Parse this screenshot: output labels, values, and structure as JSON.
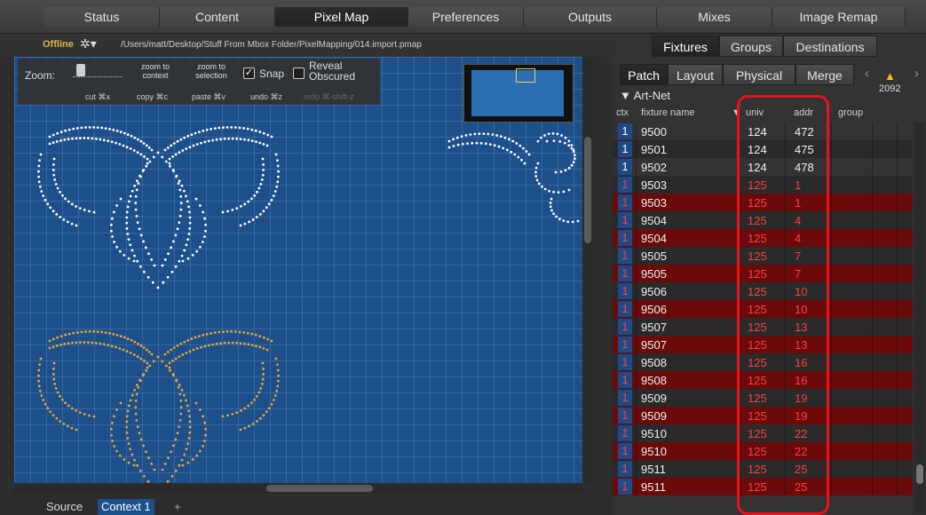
{
  "top_tabs": [
    {
      "label": "Status",
      "active": false
    },
    {
      "label": "Content",
      "active": false
    },
    {
      "label": "Pixel Map",
      "active": true
    },
    {
      "label": "Preferences",
      "active": false
    },
    {
      "label": "Outputs",
      "active": false
    },
    {
      "label": "Mixes",
      "active": false
    },
    {
      "label": "Image Remap",
      "active": false
    }
  ],
  "status": {
    "offline_label": "Offline",
    "gear_icon": "gear-dropdown-icon"
  },
  "file_path": "/Users/matt/Desktop/Stuff From Mbox Folder/PixelMapping/014.import.pmap",
  "toolbar": {
    "zoom_label": "Zoom:",
    "zoom_to_context": "zoom to\ncontext",
    "zoom_to_selection": "zoom to\nselection",
    "snap_label": "Snap",
    "snap_checked": true,
    "reveal_label": "Reveal\nObscured",
    "reveal_checked": false,
    "cut": "cut ⌘x",
    "copy": "copy ⌘c",
    "paste": "paste ⌘v",
    "undo": "undo ⌘z",
    "redo": "redo ⌘-shift-z"
  },
  "bottom_tabs": [
    {
      "label": "Source",
      "active": false
    },
    {
      "label": "Context 1",
      "active": true
    },
    {
      "label": "+",
      "active": false
    }
  ],
  "panel": {
    "main_tabs": [
      {
        "label": "Fixtures",
        "active": true
      },
      {
        "label": "Groups",
        "active": false
      },
      {
        "label": "Destinations",
        "active": false
      }
    ],
    "sub_tabs": [
      {
        "label": "Patch",
        "active": true
      },
      {
        "label": "Layout",
        "active": false
      },
      {
        "label": "Physical",
        "active": false
      },
      {
        "label": "Merge",
        "active": false
      }
    ],
    "warning_count": "2092",
    "group_header": "▼ Art-Net",
    "columns": {
      "ctx": "ctx",
      "fixture_name": "fixture name",
      "univ": "univ",
      "addr": "addr",
      "group": "group"
    },
    "rows": [
      {
        "ctx": "1",
        "name": "9500",
        "univ": "124",
        "addr": "472",
        "conflict": false
      },
      {
        "ctx": "1",
        "name": "9501",
        "univ": "124",
        "addr": "475",
        "conflict": false
      },
      {
        "ctx": "1",
        "name": "9502",
        "univ": "124",
        "addr": "478",
        "conflict": false
      },
      {
        "ctx": "1",
        "name": "9503",
        "univ": "125",
        "addr": "1",
        "conflict": true
      },
      {
        "ctx": "1",
        "name": "9503",
        "univ": "125",
        "addr": "1",
        "conflict": true
      },
      {
        "ctx": "1",
        "name": "9504",
        "univ": "125",
        "addr": "4",
        "conflict": true
      },
      {
        "ctx": "1",
        "name": "9504",
        "univ": "125",
        "addr": "4",
        "conflict": true
      },
      {
        "ctx": "1",
        "name": "9505",
        "univ": "125",
        "addr": "7",
        "conflict": true
      },
      {
        "ctx": "1",
        "name": "9505",
        "univ": "125",
        "addr": "7",
        "conflict": true
      },
      {
        "ctx": "1",
        "name": "9506",
        "univ": "125",
        "addr": "10",
        "conflict": true
      },
      {
        "ctx": "1",
        "name": "9506",
        "univ": "125",
        "addr": "10",
        "conflict": true
      },
      {
        "ctx": "1",
        "name": "9507",
        "univ": "125",
        "addr": "13",
        "conflict": true
      },
      {
        "ctx": "1",
        "name": "9507",
        "univ": "125",
        "addr": "13",
        "conflict": true
      },
      {
        "ctx": "1",
        "name": "9508",
        "univ": "125",
        "addr": "16",
        "conflict": true
      },
      {
        "ctx": "1",
        "name": "9508",
        "univ": "125",
        "addr": "16",
        "conflict": true
      },
      {
        "ctx": "1",
        "name": "9509",
        "univ": "125",
        "addr": "19",
        "conflict": true
      },
      {
        "ctx": "1",
        "name": "9509",
        "univ": "125",
        "addr": "19",
        "conflict": true
      },
      {
        "ctx": "1",
        "name": "9510",
        "univ": "125",
        "addr": "22",
        "conflict": true
      },
      {
        "ctx": "1",
        "name": "9510",
        "univ": "125",
        "addr": "22",
        "conflict": true
      },
      {
        "ctx": "1",
        "name": "9511",
        "univ": "125",
        "addr": "25",
        "conflict": true
      },
      {
        "ctx": "1",
        "name": "9511",
        "univ": "125",
        "addr": "25",
        "conflict": true
      }
    ]
  },
  "colors": {
    "canvas_bg": "#1d4f8a",
    "fixture_white": "#ffffff",
    "fixture_orange": "#e8a63a",
    "conflict_red": "#ff4040",
    "conflict_row_dark": "#6a0a0a",
    "highlight_outline": "#e8121d",
    "offline_yellow": "#d6b64a"
  }
}
